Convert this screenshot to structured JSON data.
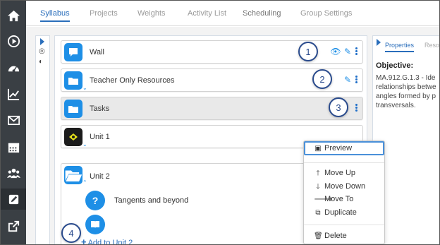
{
  "tabs": [
    {
      "label": "Syllabus"
    },
    {
      "label": "Projects"
    },
    {
      "label": "Weights"
    },
    {
      "label": "Activity List"
    },
    {
      "label": "Scheduling"
    },
    {
      "label": "Group Settings"
    }
  ],
  "rail_icons": [
    "home-icon",
    "play-icon",
    "dashboard-icon",
    "chart-icon",
    "mail-icon",
    "calendar-icon",
    "users-icon",
    "pencil-icon",
    "external-link-icon"
  ],
  "rows": [
    {
      "label": "Wall"
    },
    {
      "label": "Teacher Only Resources"
    },
    {
      "label": "Tasks"
    },
    {
      "label": "Unit 1"
    },
    {
      "label": "Unit 2"
    }
  ],
  "unit2_items": [
    {
      "label": "Tangents and beyond"
    }
  ],
  "add_link": "Add to Unit 2",
  "menu": {
    "preview": "Preview",
    "move_up": "Move Up",
    "move_down": "Move Down",
    "move_to": "Move To",
    "duplicate": "Duplicate",
    "delete": "Delete"
  },
  "right_panel": {
    "tab_properties": "Properties",
    "tab_resources": "Reso",
    "objective_heading": "Objective:",
    "objective_lines": [
      "MA.912.G.1.3 - Ide",
      "relationships betwe",
      "angles formed by p",
      "transversals."
    ]
  },
  "callouts": [
    "1",
    "2",
    "3",
    "4"
  ],
  "colors": {
    "accent": "#1e8fe6",
    "link": "#2a6ebb",
    "rail": "#3a3f44",
    "callout": "#2a4b8d"
  }
}
